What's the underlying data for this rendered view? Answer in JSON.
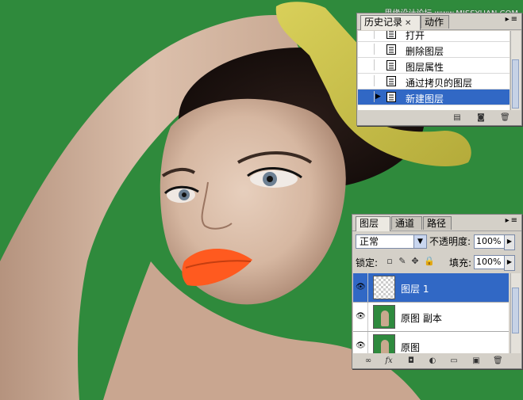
{
  "watermark": "思缘设计论坛 www.MISSYUAN.COM",
  "colors": {
    "background_green": "#2f8a3c",
    "selection": "#3168c5"
  },
  "history_panel": {
    "tabs": [
      {
        "label": "历史记录",
        "active": true
      },
      {
        "label": "动作",
        "active": false
      }
    ],
    "items": [
      {
        "label": "打开",
        "selected": false
      },
      {
        "label": "删除图层",
        "selected": false
      },
      {
        "label": "图层属性",
        "selected": false
      },
      {
        "label": "通过拷贝的图层",
        "selected": false
      },
      {
        "label": "新建图层",
        "selected": true
      }
    ],
    "footer_icons": [
      "new-document-from-state-icon",
      "camera-snapshot-icon",
      "trash-icon"
    ]
  },
  "layers_panel": {
    "tabs": [
      {
        "label": "图层",
        "active": true
      },
      {
        "label": "通道",
        "active": false
      },
      {
        "label": "路径",
        "active": false
      }
    ],
    "blend_mode": "正常",
    "opacity_label": "不透明度:",
    "opacity_value": "100%",
    "lock_label": "锁定:",
    "fill_label": "填充:",
    "fill_value": "100%",
    "layers": [
      {
        "name": "图层 1",
        "visible": true,
        "selected": true,
        "thumb": "transparent"
      },
      {
        "name": "原图 副本",
        "visible": true,
        "selected": false,
        "thumb": "photo"
      },
      {
        "name": "原图",
        "visible": true,
        "selected": false,
        "thumb": "photo"
      }
    ],
    "footer_icons": [
      "link-icon",
      "fx-icon",
      "mask-icon",
      "adjustment-icon",
      "folder-icon",
      "new-layer-icon",
      "trash-icon"
    ]
  }
}
